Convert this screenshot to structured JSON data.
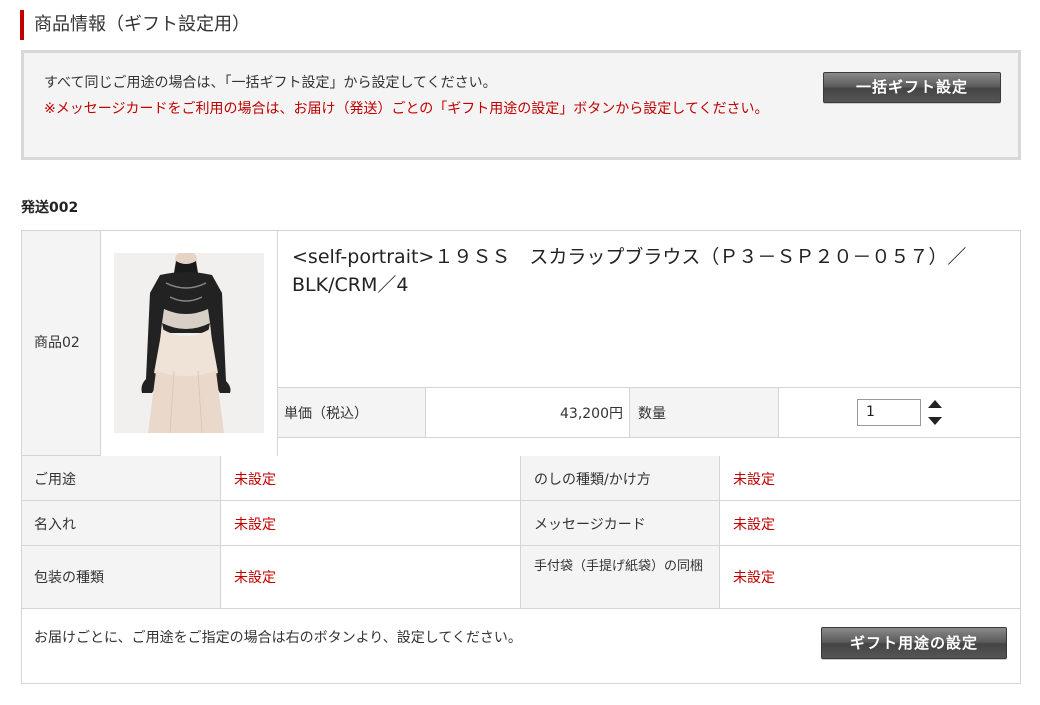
{
  "section": {
    "title": "商品情報（ギフト設定用）"
  },
  "notice": {
    "line1": "すべて同じご用途の場合は、「一括ギフト設定」から設定してください。",
    "line2": "※メッセージカードをご利用の場合は、お届け（発送）ごとの「ギフト用途の設定」ボタンから設定してください。",
    "bulk_button": "一括ギフト設定"
  },
  "shipment": {
    "label": "発送002",
    "item_label": "商品02",
    "product_name": "<self-portrait>１９ＳＳ　スカラップブラウス（Ｐ３－ＳＰ２０－０５７）／BLK/CRM／4",
    "price_label": "単価（税込）",
    "price_value": "43,200円",
    "qty_label": "数量",
    "qty_value": "1",
    "rows": [
      {
        "label_a": "ご用途",
        "value_a": "未設定",
        "label_b": "のしの種類/かけ方",
        "value_b": "未設定"
      },
      {
        "label_a": "名入れ",
        "value_a": "未設定",
        "label_b": "メッセージカード",
        "value_b": "未設定"
      },
      {
        "label_a": "包装の種類",
        "value_a": "未設定",
        "label_b": "手付袋（手提げ紙袋）の同梱",
        "value_b": "未設定"
      }
    ],
    "footer_text": "お届けごとに、ご用途をご指定の場合は右のボタンより、設定してください。",
    "gift_button": "ギフト用途の設定"
  },
  "colors": {
    "accent_red": "#c00000",
    "border": "#d4d4d4",
    "panel_bg": "#f4f4f4",
    "button_dark": "#555555"
  }
}
